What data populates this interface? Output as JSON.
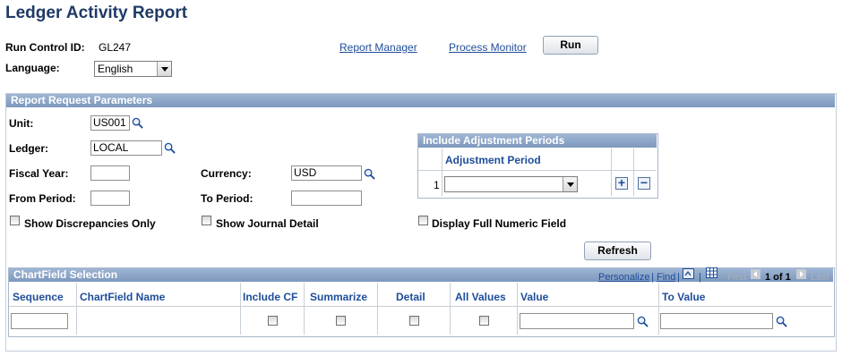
{
  "page": {
    "title": "Ledger Activity Report"
  },
  "run_control": {
    "label": "Run Control ID:",
    "value": "GL247"
  },
  "language": {
    "label": "Language:",
    "value": "English"
  },
  "links": {
    "report_manager": "Report Manager",
    "process_monitor": "Process Monitor"
  },
  "buttons": {
    "run": "Run",
    "refresh": "Refresh"
  },
  "params": {
    "header": "Report Request Parameters",
    "unit": {
      "label": "Unit:",
      "value": "US001"
    },
    "ledger": {
      "label": "Ledger:",
      "value": "LOCAL"
    },
    "fiscal_year": {
      "label": "Fiscal Year:",
      "value": ""
    },
    "currency": {
      "label": "Currency:",
      "value": "USD"
    },
    "from_period": {
      "label": "From Period:",
      "value": ""
    },
    "to_period": {
      "label": "To Period:",
      "value": ""
    },
    "show_discrepancies": "Show Discrepancies Only",
    "show_journal_detail": "Show Journal Detail",
    "display_full_numeric": "Display Full Numeric Field"
  },
  "adjustment": {
    "header": "Include Adjustment Periods",
    "column": "Adjustment Period",
    "row_number": "1",
    "value": ""
  },
  "chartfield": {
    "header": "ChartField Selection",
    "personalize": "Personalize",
    "find": "Find",
    "separator": "|",
    "first": "First",
    "count": "1 of 1",
    "last": "Last",
    "columns": {
      "sequence": "Sequence",
      "chartfield_name": "ChartField Name",
      "include_cf": "Include CF",
      "summarize": "Summarize",
      "detail": "Detail",
      "all_values": "All Values",
      "value": "Value",
      "to_value": "To Value"
    }
  },
  "colors": {
    "title": "#1f3a66",
    "link": "#1e4d99",
    "header_bg": "#8ba4c6"
  },
  "icons": {
    "lookup": "magnifier-icon",
    "add_row": "plus-icon",
    "delete_row": "minus-icon",
    "view_all": "zoom-icon",
    "download": "grid-download-icon",
    "first": "arrow-left-icon",
    "last": "arrow-right-icon"
  }
}
